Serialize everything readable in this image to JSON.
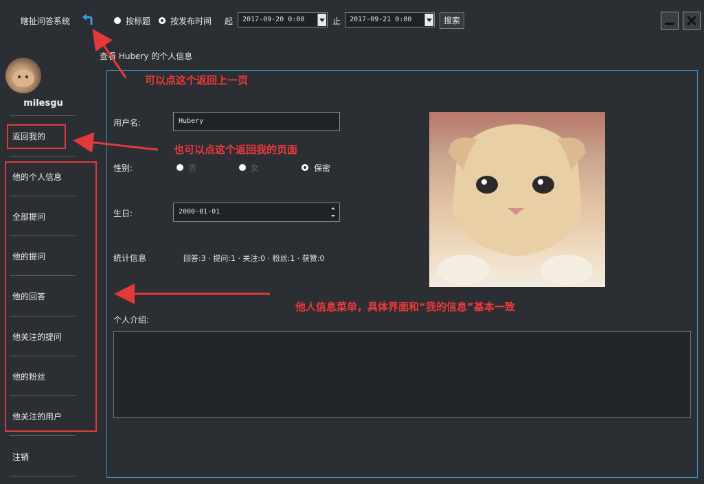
{
  "app": {
    "title": "瞎扯问答系统"
  },
  "search": {
    "option_title": "按标题",
    "option_time": "按发布时间",
    "from_label": "起",
    "from_value": "2017-09-20 0:00",
    "to_label": "止",
    "to_value": "2017-09-21 0:00",
    "button": "搜索"
  },
  "user": {
    "name": "milesgu"
  },
  "sidebar": {
    "items": [
      {
        "label": "返回我的"
      },
      {
        "label": "他的个人信息"
      },
      {
        "label": "全部提问"
      },
      {
        "label": "他的提问"
      },
      {
        "label": "他的回答"
      },
      {
        "label": "他关注的提问"
      },
      {
        "label": "他的粉丝"
      },
      {
        "label": "他关注的用户"
      },
      {
        "label": "注销"
      }
    ]
  },
  "main": {
    "header": "查看 Hubery 的个人信息",
    "username_label": "用户名:",
    "username_value": "Hubery",
    "gender_label": "性别:",
    "gender_male": "男",
    "gender_female": "女",
    "gender_secret": "保密",
    "birthday_label": "生日:",
    "birthday_value": "2000-01-01",
    "stats_label": "统计信息",
    "stats_value": "回答:3 · 提问:1 · 关注:0 · 粉丝:1 · 获赞:0",
    "intro_label": "个人介绍:"
  },
  "annotations": {
    "back": "可以点这个返回上一页",
    "back_mine": "也可以点这个返回我的页面",
    "menu": "他人信息菜单，具体界面和“我的信息”基本一致"
  },
  "colors": {
    "accent": "#3d94c9",
    "annotation": "#e23a3a",
    "background": "#2b2e33"
  }
}
